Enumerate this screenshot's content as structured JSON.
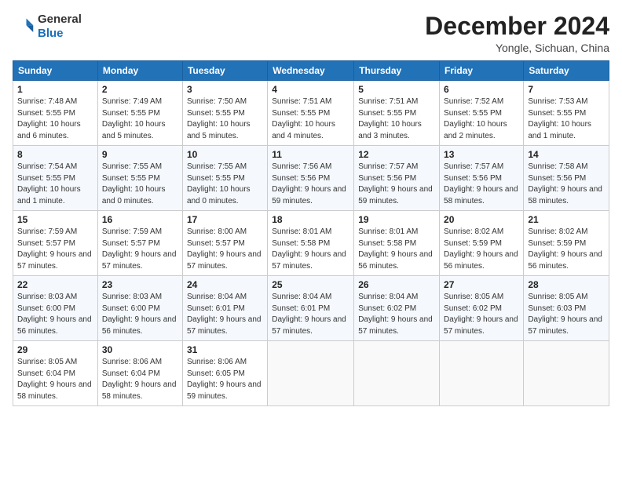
{
  "header": {
    "logo_line1": "General",
    "logo_line2": "Blue",
    "month": "December 2024",
    "location": "Yongle, Sichuan, China"
  },
  "weekdays": [
    "Sunday",
    "Monday",
    "Tuesday",
    "Wednesday",
    "Thursday",
    "Friday",
    "Saturday"
  ],
  "weeks": [
    [
      {
        "day": "1",
        "sunrise": "7:48 AM",
        "sunset": "5:55 PM",
        "daylight": "10 hours and 6 minutes."
      },
      {
        "day": "2",
        "sunrise": "7:49 AM",
        "sunset": "5:55 PM",
        "daylight": "10 hours and 5 minutes."
      },
      {
        "day": "3",
        "sunrise": "7:50 AM",
        "sunset": "5:55 PM",
        "daylight": "10 hours and 5 minutes."
      },
      {
        "day": "4",
        "sunrise": "7:51 AM",
        "sunset": "5:55 PM",
        "daylight": "10 hours and 4 minutes."
      },
      {
        "day": "5",
        "sunrise": "7:51 AM",
        "sunset": "5:55 PM",
        "daylight": "10 hours and 3 minutes."
      },
      {
        "day": "6",
        "sunrise": "7:52 AM",
        "sunset": "5:55 PM",
        "daylight": "10 hours and 2 minutes."
      },
      {
        "day": "7",
        "sunrise": "7:53 AM",
        "sunset": "5:55 PM",
        "daylight": "10 hours and 1 minute."
      }
    ],
    [
      {
        "day": "8",
        "sunrise": "7:54 AM",
        "sunset": "5:55 PM",
        "daylight": "10 hours and 1 minute."
      },
      {
        "day": "9",
        "sunrise": "7:55 AM",
        "sunset": "5:55 PM",
        "daylight": "10 hours and 0 minutes."
      },
      {
        "day": "10",
        "sunrise": "7:55 AM",
        "sunset": "5:55 PM",
        "daylight": "10 hours and 0 minutes."
      },
      {
        "day": "11",
        "sunrise": "7:56 AM",
        "sunset": "5:56 PM",
        "daylight": "9 hours and 59 minutes."
      },
      {
        "day": "12",
        "sunrise": "7:57 AM",
        "sunset": "5:56 PM",
        "daylight": "9 hours and 59 minutes."
      },
      {
        "day": "13",
        "sunrise": "7:57 AM",
        "sunset": "5:56 PM",
        "daylight": "9 hours and 58 minutes."
      },
      {
        "day": "14",
        "sunrise": "7:58 AM",
        "sunset": "5:56 PM",
        "daylight": "9 hours and 58 minutes."
      }
    ],
    [
      {
        "day": "15",
        "sunrise": "7:59 AM",
        "sunset": "5:57 PM",
        "daylight": "9 hours and 57 minutes."
      },
      {
        "day": "16",
        "sunrise": "7:59 AM",
        "sunset": "5:57 PM",
        "daylight": "9 hours and 57 minutes."
      },
      {
        "day": "17",
        "sunrise": "8:00 AM",
        "sunset": "5:57 PM",
        "daylight": "9 hours and 57 minutes."
      },
      {
        "day": "18",
        "sunrise": "8:01 AM",
        "sunset": "5:58 PM",
        "daylight": "9 hours and 57 minutes."
      },
      {
        "day": "19",
        "sunrise": "8:01 AM",
        "sunset": "5:58 PM",
        "daylight": "9 hours and 56 minutes."
      },
      {
        "day": "20",
        "sunrise": "8:02 AM",
        "sunset": "5:59 PM",
        "daylight": "9 hours and 56 minutes."
      },
      {
        "day": "21",
        "sunrise": "8:02 AM",
        "sunset": "5:59 PM",
        "daylight": "9 hours and 56 minutes."
      }
    ],
    [
      {
        "day": "22",
        "sunrise": "8:03 AM",
        "sunset": "6:00 PM",
        "daylight": "9 hours and 56 minutes."
      },
      {
        "day": "23",
        "sunrise": "8:03 AM",
        "sunset": "6:00 PM",
        "daylight": "9 hours and 56 minutes."
      },
      {
        "day": "24",
        "sunrise": "8:04 AM",
        "sunset": "6:01 PM",
        "daylight": "9 hours and 57 minutes."
      },
      {
        "day": "25",
        "sunrise": "8:04 AM",
        "sunset": "6:01 PM",
        "daylight": "9 hours and 57 minutes."
      },
      {
        "day": "26",
        "sunrise": "8:04 AM",
        "sunset": "6:02 PM",
        "daylight": "9 hours and 57 minutes."
      },
      {
        "day": "27",
        "sunrise": "8:05 AM",
        "sunset": "6:02 PM",
        "daylight": "9 hours and 57 minutes."
      },
      {
        "day": "28",
        "sunrise": "8:05 AM",
        "sunset": "6:03 PM",
        "daylight": "9 hours and 57 minutes."
      }
    ],
    [
      {
        "day": "29",
        "sunrise": "8:05 AM",
        "sunset": "6:04 PM",
        "daylight": "9 hours and 58 minutes."
      },
      {
        "day": "30",
        "sunrise": "8:06 AM",
        "sunset": "6:04 PM",
        "daylight": "9 hours and 58 minutes."
      },
      {
        "day": "31",
        "sunrise": "8:06 AM",
        "sunset": "6:05 PM",
        "daylight": "9 hours and 59 minutes."
      },
      null,
      null,
      null,
      null
    ]
  ]
}
